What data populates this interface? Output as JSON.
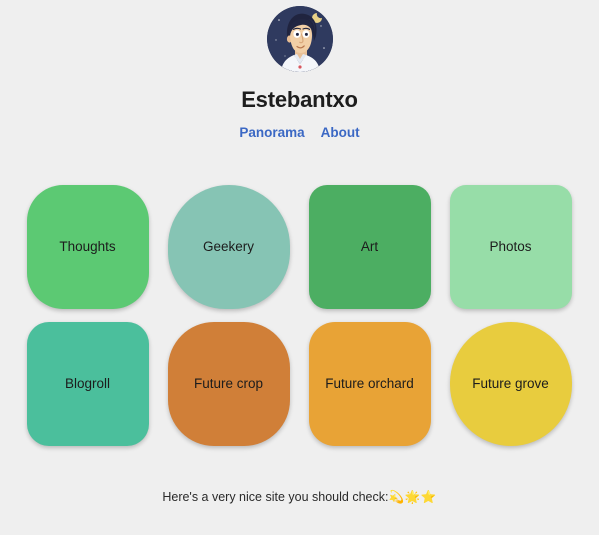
{
  "page": {
    "background_color": "#efefef",
    "text_color": "#1c1c1c"
  },
  "header": {
    "avatar_icon": "avatar-cartoon-face-night-sky",
    "title": "Estebantxo",
    "nav": {
      "link_color": "#3b68c4",
      "items": [
        {
          "label": "Panorama"
        },
        {
          "label": "About"
        }
      ]
    }
  },
  "grid": {
    "tiles": [
      {
        "label": "Thoughts",
        "color": "#5cc973",
        "radius": "36px"
      },
      {
        "label": "Geekery",
        "color": "#86c4b4",
        "radius": "62px 62px 58px 58px"
      },
      {
        "label": "Art",
        "color": "#4cae62",
        "radius": "18px"
      },
      {
        "label": "Photos",
        "color": "#97dda8",
        "radius": "16px"
      },
      {
        "label": "Blogroll",
        "color": "#4bbf9c",
        "radius": "22px"
      },
      {
        "label": "Future crop",
        "color": "#d07f38",
        "radius": "46px"
      },
      {
        "label": "Future orchard",
        "color": "#e8a336",
        "radius": "26px"
      },
      {
        "label": "Future grove",
        "color": "#e8cc3e",
        "radius": "62px"
      }
    ]
  },
  "footer": {
    "text": "Here's a very nice site you should check:",
    "emoji": "💫🌟⭐"
  }
}
